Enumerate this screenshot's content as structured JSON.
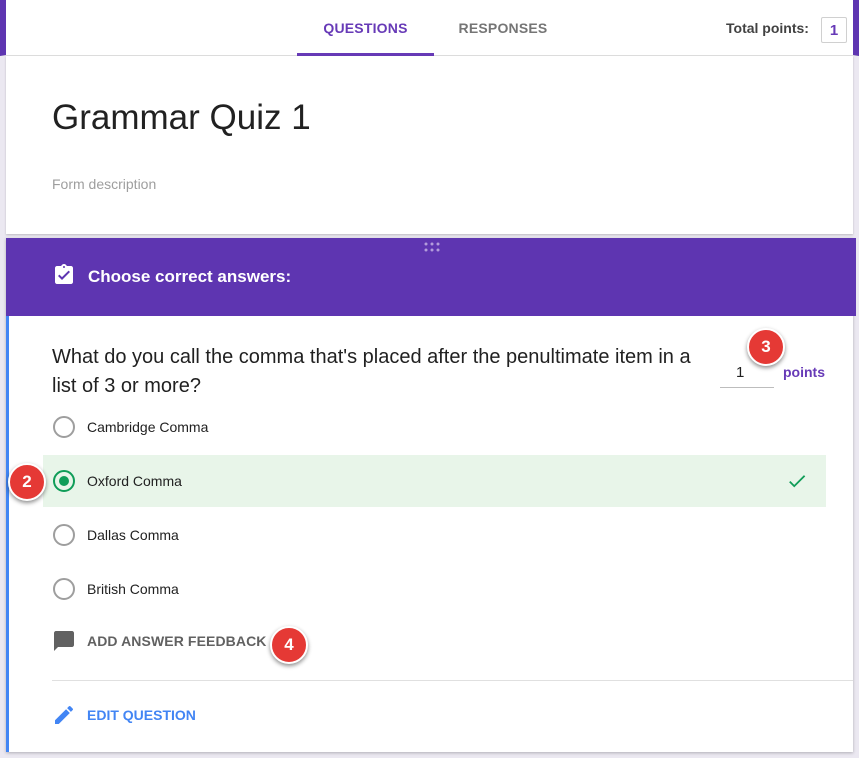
{
  "header": {
    "tabs": [
      {
        "label": "QUESTIONS",
        "active": true
      },
      {
        "label": "RESPONSES",
        "active": false
      }
    ],
    "total_points_label": "Total points:",
    "total_points_value": "1"
  },
  "form": {
    "title": "Grammar Quiz 1",
    "description_placeholder": "Form description"
  },
  "question_card": {
    "band_title": "Choose correct answers:",
    "question": "What do you call the comma that's placed after the penultimate item in a list of 3 or more?",
    "points_value": "1",
    "points_label": "points",
    "options": [
      {
        "label": "Cambridge Comma",
        "selected": false
      },
      {
        "label": "Oxford Comma",
        "selected": true,
        "correct": true
      },
      {
        "label": "Dallas Comma",
        "selected": false
      },
      {
        "label": "British Comma",
        "selected": false
      }
    ],
    "feedback_label": "ADD ANSWER FEEDBACK",
    "edit_label": "EDIT QUESTION"
  },
  "callouts": [
    "2",
    "3",
    "4"
  ],
  "colors": {
    "accent": "#673ab7",
    "band": "#5e35b1",
    "correct_bg": "#e8f5e9",
    "correct_green": "#0f9d58",
    "link_blue": "#4285f4",
    "callout_red": "#e53935"
  }
}
